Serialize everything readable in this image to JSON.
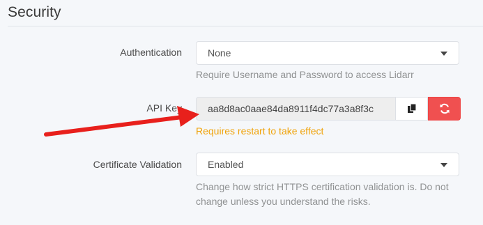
{
  "section": {
    "title": "Security"
  },
  "authentication": {
    "label": "Authentication",
    "value": "None",
    "help": "Require Username and Password to access Lidarr"
  },
  "api_key": {
    "label": "API Key",
    "value": "aa8d8ac0aae84da8911f4dc77a3a8f3c",
    "warning": "Requires restart to take effect"
  },
  "certificate_validation": {
    "label": "Certificate Validation",
    "value": "Enabled",
    "help": "Change how strict HTTPS certification validation is. Do not change unless you understand the risks."
  },
  "icons": {
    "copy": "clipboard-icon",
    "regenerate": "refresh-icon",
    "dropdown": "chevron-down-icon",
    "annotation": "red-arrow"
  },
  "colors": {
    "background": "#f5f7fa",
    "danger_button": "#f05050",
    "warning_text": "#f0a30a",
    "help_text": "#909293",
    "annotation_arrow": "#e8201c"
  }
}
